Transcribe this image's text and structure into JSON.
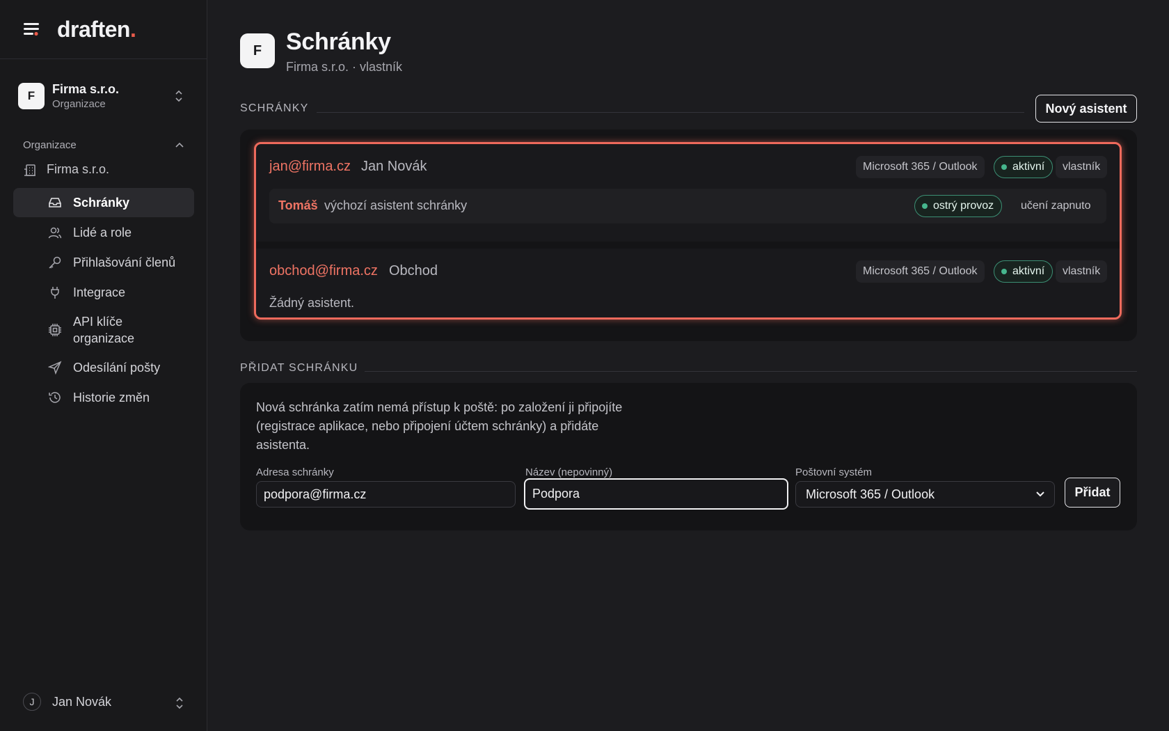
{
  "brand": {
    "logo_text": "draften",
    "logo_dot": "."
  },
  "sidebar": {
    "org": {
      "initial": "F",
      "name": "Firma s.r.o.",
      "subtitle": "Organizace"
    },
    "section_title": "Organizace",
    "org_root_label": "Firma s.r.o.",
    "items": [
      {
        "label": "Schránky",
        "icon": "inbox-icon",
        "active": true
      },
      {
        "label": "Lidé a role",
        "icon": "users-icon"
      },
      {
        "label": "Přihlašování členů",
        "icon": "key-icon"
      },
      {
        "label": "Integrace",
        "icon": "plug-icon"
      },
      {
        "label": "API klíče organizace",
        "icon": "chip-icon"
      },
      {
        "label": "Odesílání pošty",
        "icon": "send-icon"
      },
      {
        "label": "Historie změn",
        "icon": "history-icon"
      }
    ],
    "user": {
      "initial": "J",
      "name": "Jan Novák"
    }
  },
  "header": {
    "initial": "F",
    "title": "Schránky",
    "subtitle": "Firma s.r.o. · vlastník"
  },
  "mailboxes_section": {
    "label": "SCHRÁNKY",
    "new_assistant_label": "Nový asistent",
    "mailboxes": [
      {
        "email": "jan@firma.cz",
        "name": "Jan Novák",
        "system": "Microsoft 365 / Outlook",
        "status": "aktivní",
        "role": "vlastník",
        "assistant": {
          "name": "Tomáš",
          "description": "výchozí asistent schránky",
          "mode": "ostrý provoz",
          "learning": "učení zapnuto"
        }
      },
      {
        "email": "obchod@firma.cz",
        "name": "Obchod",
        "system": "Microsoft 365 / Outlook",
        "status": "aktivní",
        "role": "vlastník",
        "no_assistant_text": "Žádný asistent."
      }
    ]
  },
  "add_section": {
    "label": "PŘIDAT SCHRÁNKU",
    "description": "Nová schránka zatím nemá přístup k poště: po založení ji připojíte (registrace aplikace, nebo připojení účtem schránky) a přidáte asistenta.",
    "address_label": "Adresa schránky",
    "address_value": "podpora@firma.cz",
    "name_label": "Název (nepovinný)",
    "name_value": "Podpora",
    "system_label": "Poštovní systém",
    "system_value": "Microsoft 365 / Outlook",
    "submit_label": "Přidat"
  },
  "colors": {
    "accent": "#ee6a5c",
    "active_green": "#46b68d",
    "background": "#1c1c1f"
  }
}
